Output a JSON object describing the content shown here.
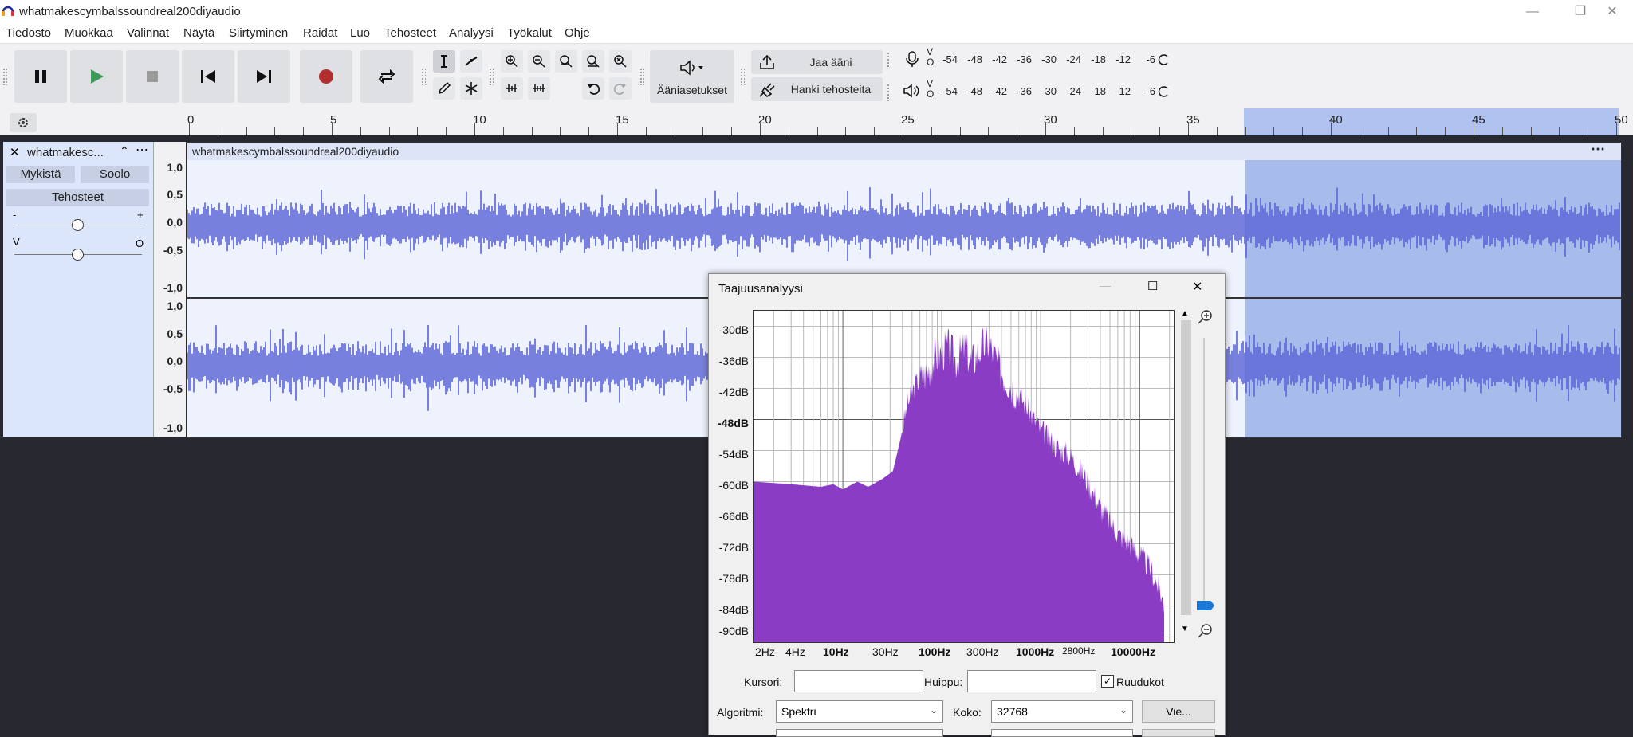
{
  "window": {
    "title": "whatmakescymbalssoundreal200diyaudio"
  },
  "menu": [
    "Tiedosto",
    "Muokkaa",
    "Valinnat",
    "Näytä",
    "Siirtyminen",
    "Raidat",
    "Luo",
    "Tehosteet",
    "Analyysi",
    "Työkalut",
    "Ohje"
  ],
  "toolbar": {
    "audio_settings_label": "Ääniasetukset",
    "share_label": "Jaa ääni",
    "effects_label": "Hanki tehosteita",
    "meter_scale": [
      "-54",
      "-48",
      "-42",
      "-36",
      "-30",
      "-24",
      "-18",
      "-12",
      "-6"
    ],
    "meter_vo": [
      "V",
      "O"
    ]
  },
  "ruler": {
    "labels": [
      "0",
      "5",
      "10",
      "15",
      "20",
      "25",
      "30",
      "35",
      "40",
      "45",
      "50"
    ]
  },
  "track": {
    "name": "whatmakesc...",
    "mute_label": "Mykistä",
    "solo_label": "Soolo",
    "effects_label": "Tehosteet",
    "gain_minus": "-",
    "gain_plus": "+",
    "pan_left": "V",
    "pan_right": "O",
    "scale": [
      "1,0",
      "0,5",
      "0,0",
      "-0,5",
      "-1,0"
    ],
    "clip_name": "whatmakescymbalssoundreal200diyaudio"
  },
  "dialog": {
    "title": "Taajuusanalyysi",
    "y_labels": [
      "-30dB",
      "-36dB",
      "-42dB",
      "-48dB",
      "-54dB",
      "-60dB",
      "-66dB",
      "-72dB",
      "-78dB",
      "-84dB",
      "-90dB"
    ],
    "x_labels": [
      "2Hz",
      "4Hz",
      "10Hz",
      "30Hz",
      "100Hz",
      "300Hz",
      "1000Hz",
      "2800Hz",
      "10000Hz"
    ],
    "cursor_label": "Kursori:",
    "peak_label": "Huippu:",
    "cursor_value": "",
    "peak_value": "",
    "grid_label": "Ruudukot",
    "algorithm_label": "Algoritmi:",
    "algorithm_value": "Spektri",
    "size_label": "Koko:",
    "size_value": "32768",
    "export_label": "Vie..."
  },
  "colors": {
    "waveform": "#5a64d6",
    "selection": "#a8bcec",
    "spectrum": "#8a3cc4",
    "record": "#b22d2d",
    "play": "#3d9a5a"
  }
}
